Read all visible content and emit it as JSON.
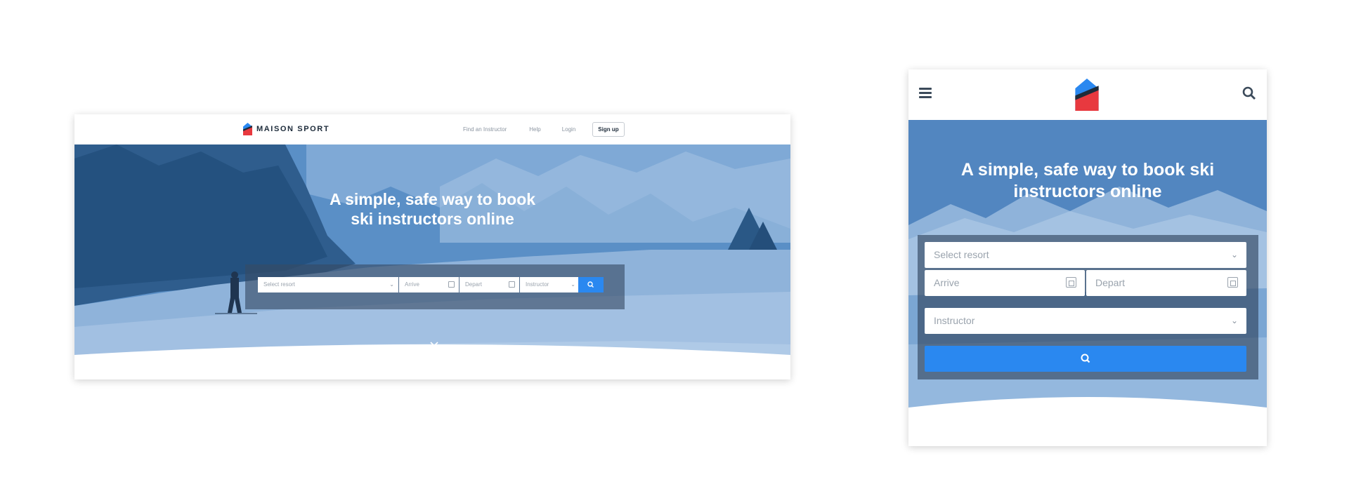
{
  "desktop": {
    "brand": "MAISON SPORT",
    "nav": {
      "find": "Find an Instructor",
      "help": "Help",
      "login": "Login",
      "signup": "Sign up"
    },
    "hero": {
      "title_line1": "A simple, safe way to book",
      "title_line2": "ski instructors online"
    },
    "search": {
      "resort": "Select resort",
      "arrive": "Arrive",
      "depart": "Depart",
      "instructor": "Instructor"
    }
  },
  "mobile": {
    "hero": {
      "title_line1": "A simple, safe way to book ski",
      "title_line2": "instructors online"
    },
    "search": {
      "resort": "Select resort",
      "arrive": "Arrive",
      "depart": "Depart",
      "instructor": "Instructor"
    }
  },
  "colors": {
    "accent": "#2a88f0",
    "logo_blue": "#2a88f0",
    "logo_red": "#e8393f",
    "logo_dark": "#1d2b3a",
    "hero_tint": "#4f86c0"
  },
  "icons": {
    "menu": "hamburger-menu-icon",
    "search": "search-icon",
    "calendar": "calendar-icon",
    "dropdown": "chevron-down-icon",
    "scroll": "chevron-down-icon"
  }
}
